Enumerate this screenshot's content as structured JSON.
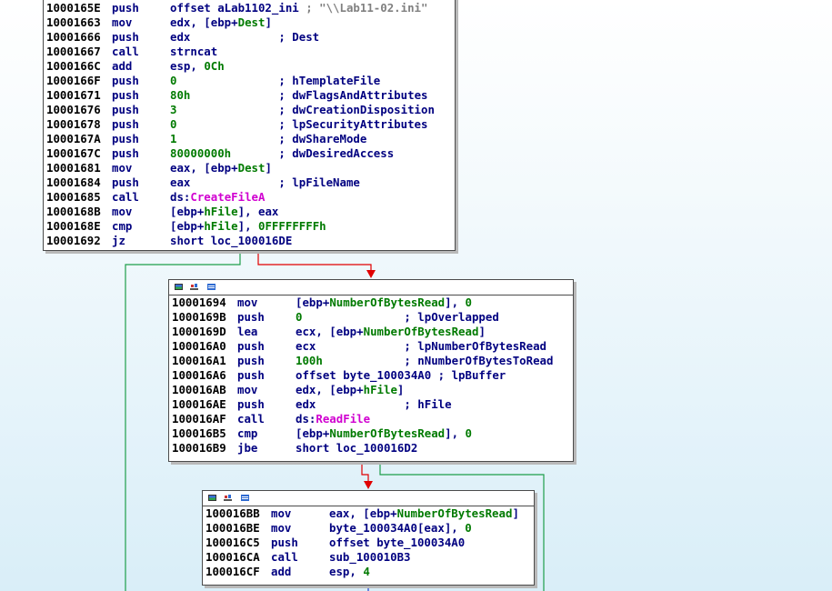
{
  "colors": {
    "default": "#000080",
    "address": "#000000",
    "var": "#007a00",
    "api": "#d000d0",
    "string": "#808080",
    "edge_true": "#1e9e4a",
    "edge_false": "#e00000",
    "edge_next": "#1e3ccf"
  },
  "blocks": [
    {
      "id": "block-createfile",
      "header_icons": [],
      "lines": [
        {
          "addr": "1000165E",
          "mn": "push",
          "parts": [
            {
              "t": "offset aLab1102_ini ",
              "c": "default"
            },
            {
              "t": "; \"\\\\Lab11-02.ini\"",
              "c": "string"
            }
          ]
        },
        {
          "addr": "10001663",
          "mn": "mov",
          "parts": [
            {
              "t": "edx, [ebp+",
              "c": "default"
            },
            {
              "t": "Dest",
              "c": "var"
            },
            {
              "t": "]",
              "c": "default"
            }
          ]
        },
        {
          "addr": "10001666",
          "mn": "push",
          "parts": [
            {
              "t": "edx             ; Dest",
              "c": "default"
            }
          ]
        },
        {
          "addr": "10001667",
          "mn": "call",
          "parts": [
            {
              "t": "strncat",
              "c": "default"
            }
          ]
        },
        {
          "addr": "1000166C",
          "mn": "add",
          "parts": [
            {
              "t": "esp, ",
              "c": "default"
            },
            {
              "t": "0Ch",
              "c": "var"
            }
          ]
        },
        {
          "addr": "1000166F",
          "mn": "push",
          "parts": [
            {
              "t": "0",
              "c": "var"
            },
            {
              "t": "               ; hTemplateFile",
              "c": "default"
            }
          ]
        },
        {
          "addr": "10001671",
          "mn": "push",
          "parts": [
            {
              "t": "80h",
              "c": "var"
            },
            {
              "t": "             ; dwFlagsAndAttributes",
              "c": "default"
            }
          ]
        },
        {
          "addr": "10001676",
          "mn": "push",
          "parts": [
            {
              "t": "3",
              "c": "var"
            },
            {
              "t": "               ; dwCreationDisposition",
              "c": "default"
            }
          ]
        },
        {
          "addr": "10001678",
          "mn": "push",
          "parts": [
            {
              "t": "0",
              "c": "var"
            },
            {
              "t": "               ; lpSecurityAttributes",
              "c": "default"
            }
          ]
        },
        {
          "addr": "1000167A",
          "mn": "push",
          "parts": [
            {
              "t": "1",
              "c": "var"
            },
            {
              "t": "               ; dwShareMode",
              "c": "default"
            }
          ]
        },
        {
          "addr": "1000167C",
          "mn": "push",
          "parts": [
            {
              "t": "80000000h",
              "c": "var"
            },
            {
              "t": "       ; dwDesiredAccess",
              "c": "default"
            }
          ]
        },
        {
          "addr": "10001681",
          "mn": "mov",
          "parts": [
            {
              "t": "eax, [ebp+",
              "c": "default"
            },
            {
              "t": "Dest",
              "c": "var"
            },
            {
              "t": "]",
              "c": "default"
            }
          ]
        },
        {
          "addr": "10001684",
          "mn": "push",
          "parts": [
            {
              "t": "eax             ; lpFileName",
              "c": "default"
            }
          ]
        },
        {
          "addr": "10001685",
          "mn": "call",
          "parts": [
            {
              "t": "ds:",
              "c": "default"
            },
            {
              "t": "CreateFileA",
              "c": "api"
            }
          ]
        },
        {
          "addr": "1000168B",
          "mn": "mov",
          "parts": [
            {
              "t": "[ebp+",
              "c": "default"
            },
            {
              "t": "hFile",
              "c": "var"
            },
            {
              "t": "], eax",
              "c": "default"
            }
          ]
        },
        {
          "addr": "1000168E",
          "mn": "cmp",
          "parts": [
            {
              "t": "[ebp+",
              "c": "default"
            },
            {
              "t": "hFile",
              "c": "var"
            },
            {
              "t": "], ",
              "c": "default"
            },
            {
              "t": "0FFFFFFFFh",
              "c": "var"
            }
          ]
        },
        {
          "addr": "10001692",
          "mn": "jz",
          "parts": [
            {
              "t": "short loc_100016DE",
              "c": "default"
            }
          ]
        }
      ]
    },
    {
      "id": "block-readfile",
      "header_icons": [
        "graph-view-icon",
        "chart-icon",
        "text-view-icon"
      ],
      "lines": [
        {
          "addr": "10001694",
          "mn": "mov",
          "parts": [
            {
              "t": "[ebp+",
              "c": "default"
            },
            {
              "t": "NumberOfBytesRead",
              "c": "var"
            },
            {
              "t": "], ",
              "c": "default"
            },
            {
              "t": "0",
              "c": "var"
            }
          ]
        },
        {
          "addr": "1000169B",
          "mn": "push",
          "parts": [
            {
              "t": "0",
              "c": "var"
            },
            {
              "t": "               ; lpOverlapped",
              "c": "default"
            }
          ]
        },
        {
          "addr": "1000169D",
          "mn": "lea",
          "parts": [
            {
              "t": "ecx, [ebp+",
              "c": "default"
            },
            {
              "t": "NumberOfBytesRead",
              "c": "var"
            },
            {
              "t": "]",
              "c": "default"
            }
          ]
        },
        {
          "addr": "100016A0",
          "mn": "push",
          "parts": [
            {
              "t": "ecx             ; lpNumberOfBytesRead",
              "c": "default"
            }
          ]
        },
        {
          "addr": "100016A1",
          "mn": "push",
          "parts": [
            {
              "t": "100h",
              "c": "var"
            },
            {
              "t": "            ; nNumberOfBytesToRead",
              "c": "default"
            }
          ]
        },
        {
          "addr": "100016A6",
          "mn": "push",
          "parts": [
            {
              "t": "offset byte_100034A0 ; lpBuffer",
              "c": "default"
            }
          ]
        },
        {
          "addr": "100016AB",
          "mn": "mov",
          "parts": [
            {
              "t": "edx, [ebp+",
              "c": "default"
            },
            {
              "t": "hFile",
              "c": "var"
            },
            {
              "t": "]",
              "c": "default"
            }
          ]
        },
        {
          "addr": "100016AE",
          "mn": "push",
          "parts": [
            {
              "t": "edx             ; hFile",
              "c": "default"
            }
          ]
        },
        {
          "addr": "100016AF",
          "mn": "call",
          "parts": [
            {
              "t": "ds:",
              "c": "default"
            },
            {
              "t": "ReadFile",
              "c": "api"
            }
          ]
        },
        {
          "addr": "100016B5",
          "mn": "cmp",
          "parts": [
            {
              "t": "[ebp+",
              "c": "default"
            },
            {
              "t": "NumberOfBytesRead",
              "c": "var"
            },
            {
              "t": "], ",
              "c": "default"
            },
            {
              "t": "0",
              "c": "var"
            }
          ]
        },
        {
          "addr": "100016B9",
          "mn": "jbe",
          "parts": [
            {
              "t": "short loc_100016D2",
              "c": "default"
            }
          ]
        }
      ]
    },
    {
      "id": "block-decode",
      "header_icons": [
        "graph-view-icon",
        "chart-icon",
        "text-view-icon"
      ],
      "lines": [
        {
          "addr": "100016BB",
          "mn": "mov",
          "parts": [
            {
              "t": "eax, [ebp+",
              "c": "default"
            },
            {
              "t": "NumberOfBytesRead",
              "c": "var"
            },
            {
              "t": "]",
              "c": "default"
            }
          ]
        },
        {
          "addr": "100016BE",
          "mn": "mov",
          "parts": [
            {
              "t": "byte_100034A0[eax], ",
              "c": "default"
            },
            {
              "t": "0",
              "c": "var"
            }
          ]
        },
        {
          "addr": "100016C5",
          "mn": "push",
          "parts": [
            {
              "t": "offset byte_100034A0",
              "c": "default"
            }
          ]
        },
        {
          "addr": "100016CA",
          "mn": "call",
          "parts": [
            {
              "t": "sub_100010B3",
              "c": "default"
            }
          ]
        },
        {
          "addr": "100016CF",
          "mn": "add",
          "parts": [
            {
              "t": "esp, ",
              "c": "default"
            },
            {
              "t": "4",
              "c": "var"
            }
          ]
        }
      ]
    }
  ]
}
